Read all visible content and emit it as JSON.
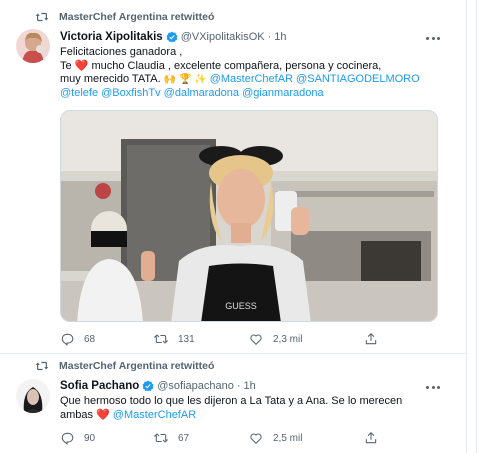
{
  "tweets": [
    {
      "retweeted_by": "MasterChef Argentina retwitteó",
      "name": "Victoria Xipolitakis",
      "handle": "@VXipolitakisOK",
      "dot": "·",
      "time": "1h",
      "lines": {
        "l1": "Felicitaciones ganadora ,",
        "l2a": "Te ",
        "l2b": " mucho Claudia , excelente compañera, persona y cocinera,",
        "l3a": "muy merecido TATA. ",
        "l3emoji": "🙌 🏆 ✨",
        "l3b": "@MasterChefAR @SANTIAGODELMORO",
        "l4": "@telefe @BoxfishTv @dalmaradona @gianmaradona"
      },
      "heart_glyph": "❤️",
      "actions": {
        "reply": "68",
        "retweet": "131",
        "like": "2,3 mil"
      }
    },
    {
      "retweeted_by": "MasterChef Argentina retwitteó",
      "name": "Sofia Pachano",
      "handle": "@sofiapachano",
      "dot": "·",
      "time": "1h",
      "lines": {
        "l1": "Que hermoso todo lo que les dijeron a La Tata  y a Ana. Se lo merecen",
        "l2a": "ambas ",
        "l2b": "@MasterChefAR"
      },
      "heart_glyph": "❤️",
      "actions": {
        "reply": "90",
        "retweet": "67",
        "like": "2,5 mil"
      }
    }
  ],
  "colors": {
    "accent": "#1d9bf0",
    "verified": "#1d9bf0",
    "heart": "#e0245e",
    "muted": "#536471",
    "divider": "#e6ecf0"
  }
}
